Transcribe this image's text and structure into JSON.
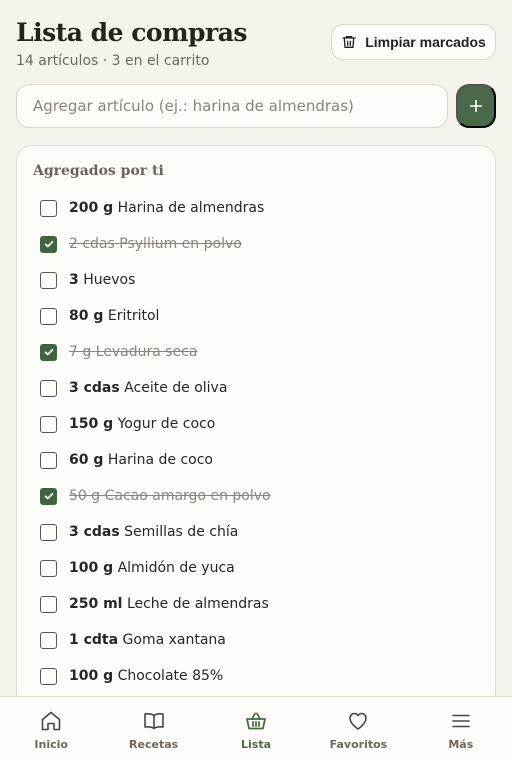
{
  "header": {
    "title": "Lista de compras",
    "subtitle": "14 artículos · 3 en el carrito",
    "clear_label": "Limpiar marcados"
  },
  "add": {
    "placeholder": "Agregar artículo (ej.: harina de almendras)"
  },
  "section": {
    "title": "Agregados por ti",
    "items": [
      {
        "qty": "200 g",
        "name": "Harina de almendras",
        "checked": false
      },
      {
        "qty": "2 cdas",
        "name": "Psyllium en polvo",
        "checked": true
      },
      {
        "qty": "3",
        "name": "Huevos",
        "checked": false
      },
      {
        "qty": "80 g",
        "name": "Eritritol",
        "checked": false
      },
      {
        "qty": "7 g",
        "name": "Levadura seca",
        "checked": true
      },
      {
        "qty": "3 cdas",
        "name": "Aceite de oliva",
        "checked": false
      },
      {
        "qty": "150 g",
        "name": "Yogur de coco",
        "checked": false
      },
      {
        "qty": "60 g",
        "name": "Harina de coco",
        "checked": false
      },
      {
        "qty": "50 g",
        "name": "Cacao amargo en polvo",
        "checked": true
      },
      {
        "qty": "3 cdas",
        "name": "Semillas de chía",
        "checked": false
      },
      {
        "qty": "100 g",
        "name": "Almidón de yuca",
        "checked": false
      },
      {
        "qty": "250 ml",
        "name": "Leche de almendras",
        "checked": false
      },
      {
        "qty": "1 cdta",
        "name": "Goma xantana",
        "checked": false
      },
      {
        "qty": "100 g",
        "name": "Chocolate 85%",
        "checked": false
      }
    ]
  },
  "nav": {
    "items": [
      {
        "label": "Inicio",
        "icon": "home-icon",
        "active": false
      },
      {
        "label": "Recetas",
        "icon": "book-icon",
        "active": false
      },
      {
        "label": "Lista",
        "icon": "basket-icon",
        "active": true
      },
      {
        "label": "Favoritos",
        "icon": "heart-icon",
        "active": false
      },
      {
        "label": "Más",
        "icon": "menu-icon",
        "active": false
      }
    ]
  },
  "colors": {
    "accent": "#49694a",
    "checkbox_checked": "#3f6443",
    "background": "#f6f3ec",
    "card": "#fdfcf8",
    "muted_text": "#8b847a"
  }
}
